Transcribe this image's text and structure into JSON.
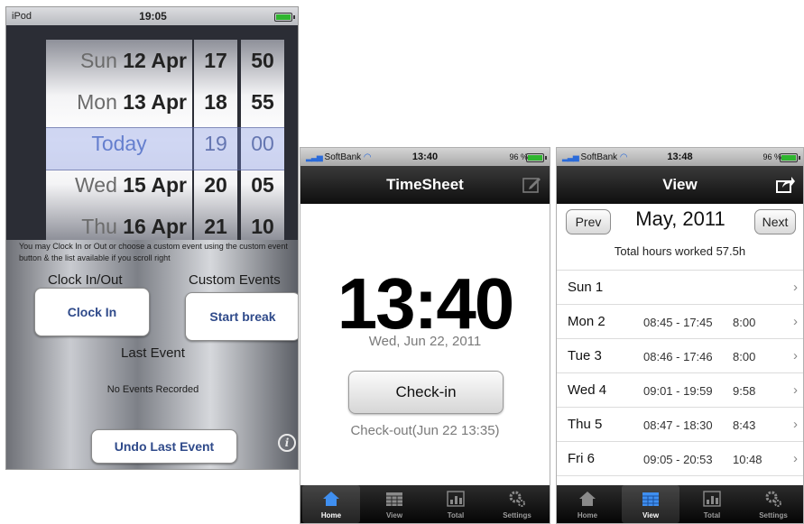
{
  "ipod": {
    "status": {
      "carrier": "iPod",
      "time": "19:05"
    },
    "picker": {
      "dates": [
        {
          "dow": "Sun",
          "day": "12 Apr"
        },
        {
          "dow": "Mon",
          "day": "13 Apr"
        },
        {
          "dow": "",
          "day": "Today"
        },
        {
          "dow": "Wed",
          "day": "15 Apr"
        },
        {
          "dow": "Thu",
          "day": "16 Apr"
        }
      ],
      "hours": [
        "17",
        "18",
        "19",
        "20",
        "21"
      ],
      "minutes": [
        "50",
        "55",
        "00",
        "05",
        "10"
      ]
    },
    "note": "You may Clock In or Out or choose a custom event using the custom event button & the list available if you scroll right",
    "clock_header": "Clock In/Out",
    "custom_header": "Custom Events",
    "clock_in_label": "Clock In",
    "start_break_label": "Start break",
    "last_event_header": "Last Event",
    "no_events": "No Events Recorded",
    "undo_label": "Undo Last Event",
    "info_glyph": "i"
  },
  "timesheet": {
    "status": {
      "carrier": "SoftBank",
      "time": "13:40",
      "battery": "96 %"
    },
    "title": "TimeSheet",
    "big_time": "13:40",
    "date": "Wed, Jun 22, 2011",
    "checkin_label": "Check-in",
    "checkout_text": "Check-out(Jun 22 13:35)",
    "tabs": [
      "Home",
      "View",
      "Total",
      "Settings"
    ],
    "active_tab": "Home"
  },
  "view": {
    "status": {
      "carrier": "SoftBank",
      "time": "13:48",
      "battery": "96 %"
    },
    "title": "View",
    "prev_label": "Prev",
    "next_label": "Next",
    "month": "May, 2011",
    "total": "Total hours worked 57.5h",
    "rows": [
      {
        "day": "Sun 1",
        "range": "",
        "duration": ""
      },
      {
        "day": "Mon 2",
        "range": "08:45 - 17:45",
        "duration": "8:00"
      },
      {
        "day": "Tue 3",
        "range": "08:46 - 17:46",
        "duration": "8:00"
      },
      {
        "day": "Wed 4",
        "range": "09:01 - 19:59",
        "duration": "9:58"
      },
      {
        "day": "Thu 5",
        "range": "08:47 - 18:30",
        "duration": "8:43"
      },
      {
        "day": "Fri 6",
        "range": "09:05 - 20:53",
        "duration": "10:48"
      }
    ],
    "tabs": [
      "Home",
      "View",
      "Total",
      "Settings"
    ],
    "active_tab": "View"
  },
  "colors": {
    "ios_blue_text": "#2f4a8a",
    "picker_today": "#5b79c6",
    "battery_green": "#2fb52f",
    "tab_active": "#ffffff",
    "tab_inactive": "#9c9c9c"
  }
}
